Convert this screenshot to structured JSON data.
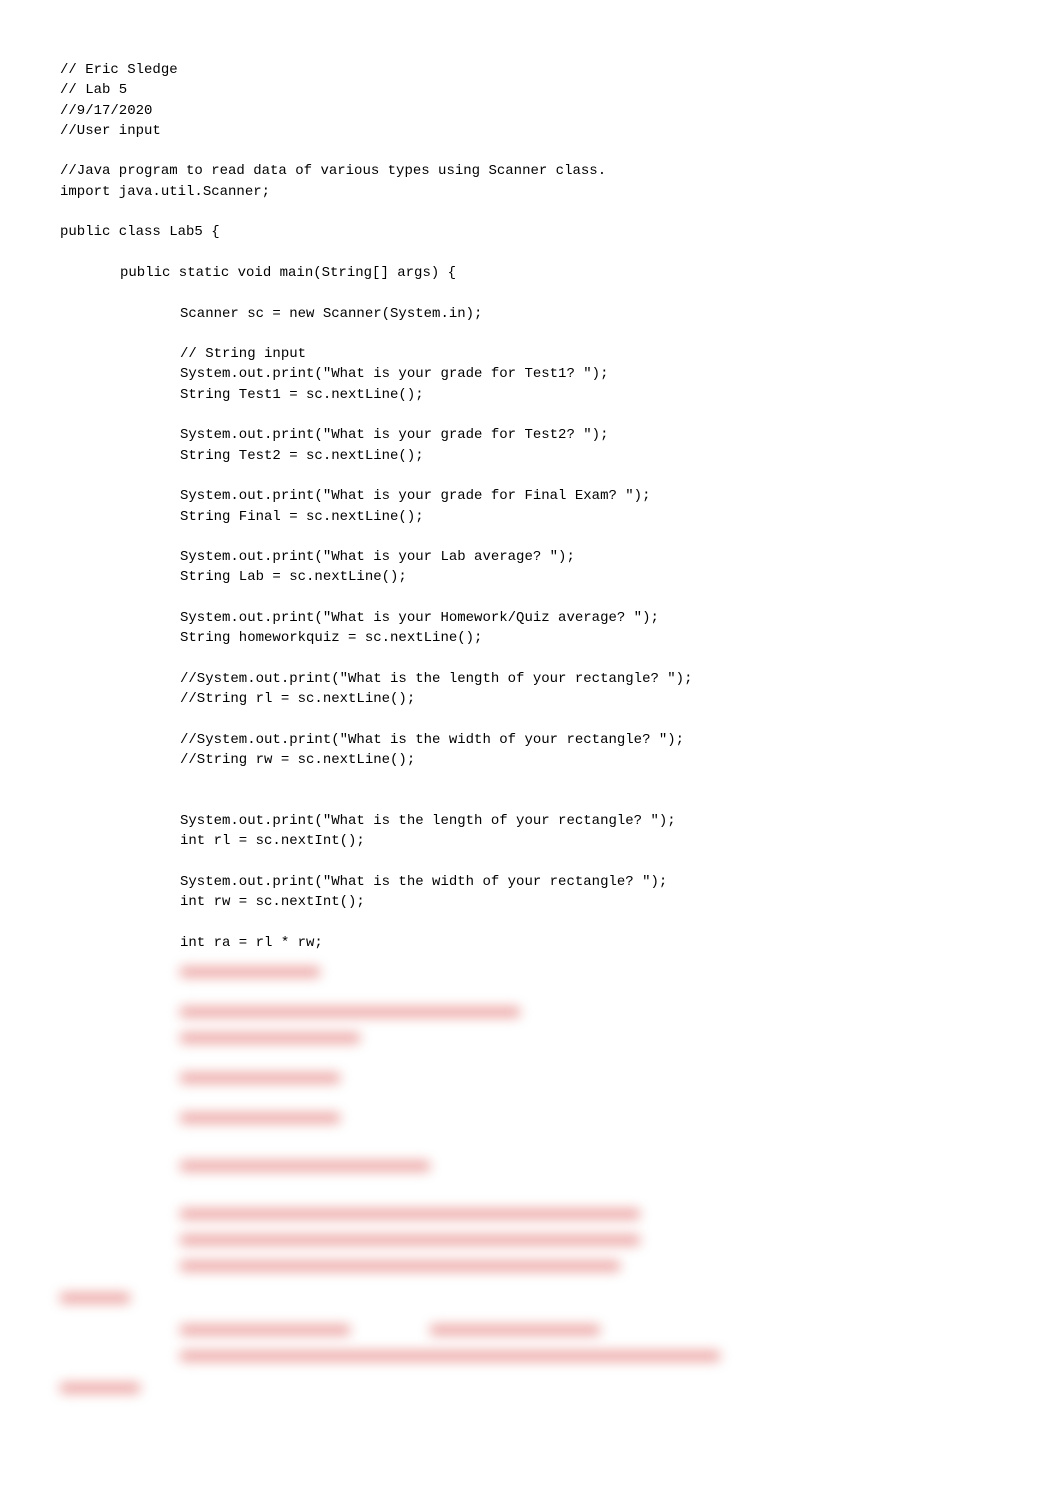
{
  "code": {
    "l1": "// Eric Sledge",
    "l2": "// Lab 5",
    "l3": "//9/17/2020",
    "l4": "//User input",
    "l5": "//Java program to read data of various types using Scanner class.",
    "l6": "import java.util.Scanner;",
    "l7": "public class Lab5 {",
    "l8": "public static void main(String[] args) {",
    "l9": "Scanner sc = new Scanner(System.in);",
    "l10": "// String input",
    "l11": "System.out.print(\"What is your grade for Test1? \");",
    "l12": "String Test1 = sc.nextLine();",
    "l13": "System.out.print(\"What is your grade for Test2? \");",
    "l14": "String Test2 = sc.nextLine();",
    "l15": "System.out.print(\"What is your grade for Final Exam? \");",
    "l16": "String Final = sc.nextLine();",
    "l17": "System.out.print(\"What is your Lab average? \");",
    "l18": "String Lab = sc.nextLine();",
    "l19": "System.out.print(\"What is your Homework/Quiz average? \");",
    "l20": "String homeworkquiz = sc.nextLine();",
    "l21": "//System.out.print(\"What is the length of your rectangle? \");",
    "l22": "//String rl = sc.nextLine();",
    "l23": "//System.out.print(\"What is the width of your rectangle? \");",
    "l24": "//String rw = sc.nextLine();",
    "l25": "System.out.print(\"What is the length of your rectangle? \");",
    "l26": "int rl = sc.nextInt();",
    "l27": "System.out.print(\"What is the width of your rectangle? \");",
    "l28": "int rw = sc.nextInt();",
    "l29": "int ra = rl * rw;"
  }
}
